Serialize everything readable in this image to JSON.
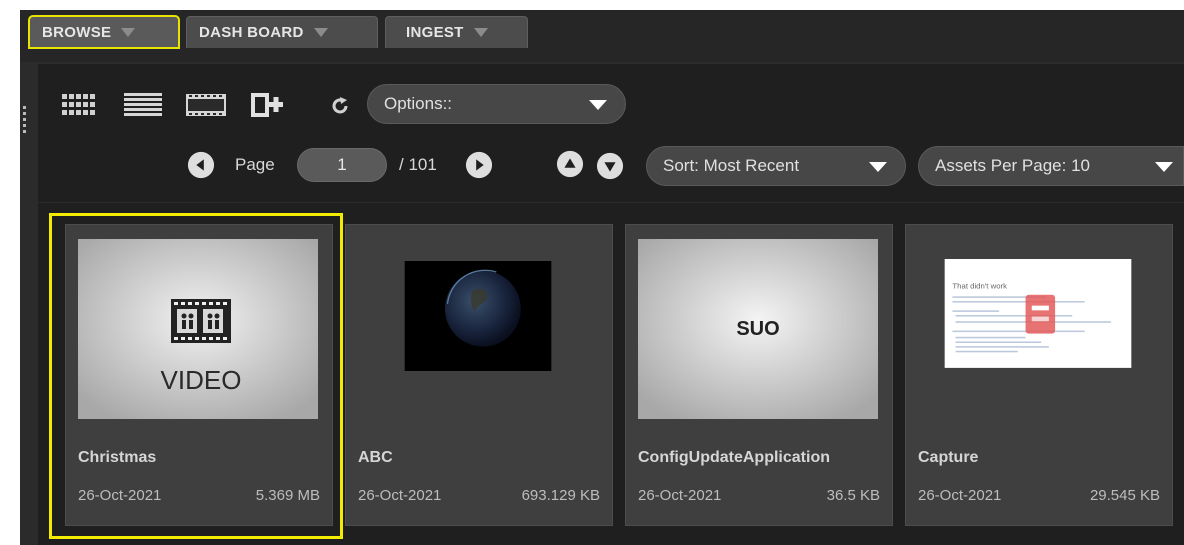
{
  "tabs": [
    {
      "label": "BROWSE",
      "active": true
    },
    {
      "label": "DASH BOARD",
      "active": false
    },
    {
      "label": "INGEST",
      "active": false
    }
  ],
  "toolbar": {
    "icons": [
      "grid-view-icon",
      "list-view-icon",
      "filmstrip-view-icon",
      "add-asset-icon",
      "refresh-icon"
    ],
    "options_label": "Options::"
  },
  "pagination": {
    "page_label": "Page",
    "current_page": "1",
    "total_label": "/ 101"
  },
  "sort": {
    "label": "Sort: Most Recent"
  },
  "per_page": {
    "label": "Assets Per Page: 10"
  },
  "assets": [
    {
      "name": "Christmas",
      "date": "26-Oct-2021",
      "size": "5.369 MB",
      "thumb_text": "VIDEO",
      "selected": true
    },
    {
      "name": "ABC",
      "date": "26-Oct-2021",
      "size": "693.129 KB",
      "thumb_text": "",
      "selected": false
    },
    {
      "name": "ConfigUpdateApplication",
      "date": "26-Oct-2021",
      "size": "36.5 KB",
      "thumb_text": "SUO",
      "selected": false
    },
    {
      "name": "Capture",
      "date": "26-Oct-2021",
      "size": "29.545 KB",
      "thumb_text": "That didn't work",
      "selected": false
    }
  ],
  "colors": {
    "selection": "#f2ed00",
    "background": "#1f1f1f",
    "card": "#3f3f3f"
  }
}
